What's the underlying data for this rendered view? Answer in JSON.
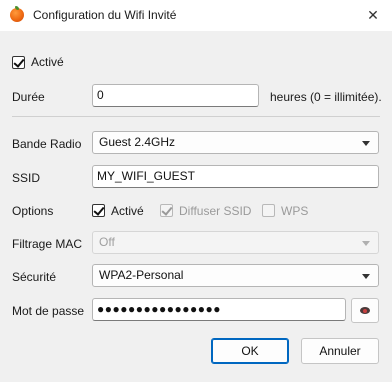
{
  "window": {
    "title": "Configuration du Wifi Invité",
    "close_glyph": "✕"
  },
  "enabled": {
    "label": "Activé",
    "checked": true
  },
  "duration": {
    "label": "Durée",
    "value": "0",
    "hint": "heures (0 = illimitée)."
  },
  "band": {
    "label": "Bande Radio",
    "value": "Guest 2.4GHz"
  },
  "ssid": {
    "label": "SSID",
    "value": "MY_WIFI_GUEST"
  },
  "options": {
    "label": "Options",
    "active": {
      "label": "Activé",
      "checked": true,
      "disabled": false
    },
    "broadcast": {
      "label": "Diffuser SSID",
      "checked": true,
      "disabled": true
    },
    "wps": {
      "label": "WPS",
      "checked": false,
      "disabled": true
    }
  },
  "mac_filter": {
    "label": "Filtrage MAC",
    "value": "Off",
    "disabled": true
  },
  "security": {
    "label": "Sécurité",
    "value": "WPA2-Personal"
  },
  "password": {
    "label": "Mot de passe",
    "value": "●●●●●●●●●●●●●●●●",
    "reveal_icon": "eye-icon"
  },
  "buttons": {
    "ok": "OK",
    "cancel": "Annuler"
  }
}
